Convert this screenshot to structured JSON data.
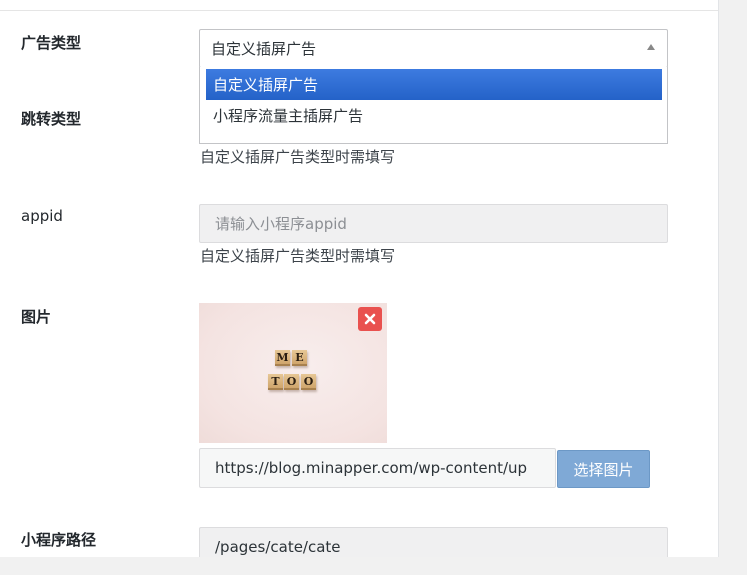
{
  "form": {
    "ad_type": {
      "label": "广告类型",
      "selected": "自定义插屏广告",
      "options": [
        "自定义插屏广告",
        "小程序流量主插屏广告"
      ]
    },
    "jump_type": {
      "label": "跳转类型",
      "hint": "自定义插屏广告类型时需填写"
    },
    "appid": {
      "label": "appid",
      "placeholder": "请输入小程序appid",
      "hint": "自定义插屏广告类型时需填写"
    },
    "image": {
      "label": "图片",
      "url": "https://blog.minapper.com/wp-content/up",
      "choose_label": "选择图片",
      "tiles_row1": [
        "M",
        "E"
      ],
      "tiles_row2": [
        "T",
        "O",
        "O"
      ]
    },
    "path": {
      "label": "小程序路径",
      "value": "/pages/cate/cate"
    }
  },
  "colors": {
    "selected_option": "#2f6fd6",
    "choose_button": "#7fa9d6",
    "remove_button": "#e9514f"
  },
  "icons": {
    "remove": "close-icon",
    "select_arrow": "triangle-up-icon"
  }
}
